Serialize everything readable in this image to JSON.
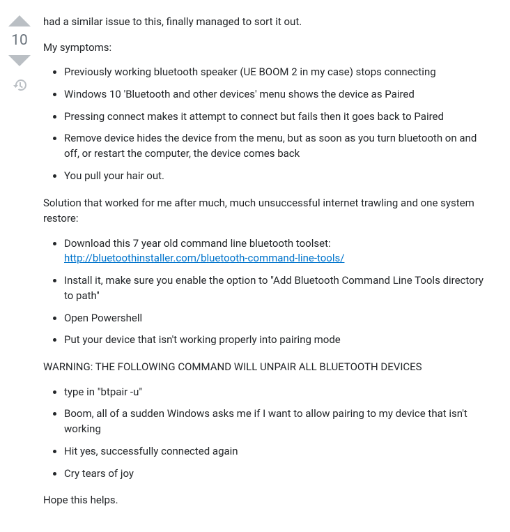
{
  "vote": {
    "score": "10"
  },
  "post": {
    "intro": "had a similar issue to this, finally managed to sort it out.",
    "symptoms_label": "My symptoms:",
    "symptoms": [
      "Previously working bluetooth speaker (UE BOOM 2 in my case) stops connecting",
      "Windows 10 'Bluetooth and other devices' menu shows the device as Paired",
      "Pressing connect makes it attempt to connect but fails then it goes back to Paired",
      "Remove device hides the device from the menu, but as soon as you turn bluetooth on and off, or restart the computer, the device comes back",
      "You pull your hair out."
    ],
    "solution_label": "Solution that worked for me after much, much unsuccessful internet trawling and one system restore:",
    "steps1_item1_text": "Download this 7 year old command line bluetooth toolset: ",
    "steps1_item1_link": "http://bluetoothinstaller.com/bluetooth-command-line-tools/",
    "steps1_item2": "Install it, make sure you enable the option to \"Add Bluetooth Command Line Tools directory to path\"",
    "steps1_item3": "Open Powershell",
    "steps1_item4": "Put your device that isn't working properly into pairing mode",
    "warning": "WARNING: THE FOLLOWING COMMAND WILL UNPAIR ALL BLUETOOTH DEVICES",
    "steps2": [
      "type in \"btpair -u\"",
      "Boom, all of a sudden Windows asks me if I want to allow pairing to my device that isn't working",
      "Hit yes, successfully connected again",
      "Cry tears of joy"
    ],
    "outro": "Hope this helps."
  }
}
